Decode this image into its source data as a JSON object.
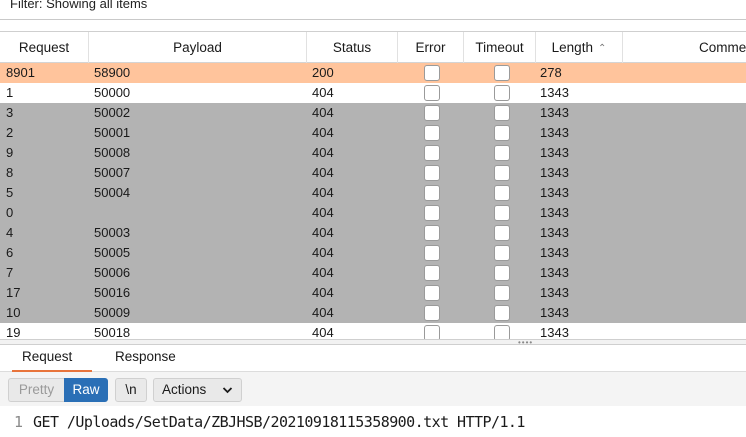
{
  "filter": {
    "text": "Filter: Showing all items"
  },
  "columns": [
    "Request",
    "Payload",
    "Status",
    "Error",
    "Timeout",
    "Length",
    "Comme"
  ],
  "sort_indicator": "^",
  "rows": [
    {
      "request": "8901",
      "payload": "58900",
      "status": "200",
      "length": "278",
      "style": "sel"
    },
    {
      "request": "1",
      "payload": "50000",
      "status": "404",
      "length": "1343",
      "style": "white"
    },
    {
      "request": "3",
      "payload": "50002",
      "status": "404",
      "length": "1343",
      "style": "gray"
    },
    {
      "request": "2",
      "payload": "50001",
      "status": "404",
      "length": "1343",
      "style": "gray"
    },
    {
      "request": "9",
      "payload": "50008",
      "status": "404",
      "length": "1343",
      "style": "gray"
    },
    {
      "request": "8",
      "payload": "50007",
      "status": "404",
      "length": "1343",
      "style": "gray"
    },
    {
      "request": "5",
      "payload": "50004",
      "status": "404",
      "length": "1343",
      "style": "gray"
    },
    {
      "request": "0",
      "payload": "",
      "status": "404",
      "length": "1343",
      "style": "gray"
    },
    {
      "request": "4",
      "payload": "50003",
      "status": "404",
      "length": "1343",
      "style": "gray"
    },
    {
      "request": "6",
      "payload": "50005",
      "status": "404",
      "length": "1343",
      "style": "gray"
    },
    {
      "request": "7",
      "payload": "50006",
      "status": "404",
      "length": "1343",
      "style": "gray"
    },
    {
      "request": "17",
      "payload": "50016",
      "status": "404",
      "length": "1343",
      "style": "gray"
    },
    {
      "request": "10",
      "payload": "50009",
      "status": "404",
      "length": "1343",
      "style": "gray"
    },
    {
      "request": "19",
      "payload": "50018",
      "status": "404",
      "length": "1343",
      "style": "white"
    }
  ],
  "tabs": {
    "request": "Request",
    "response": "Response"
  },
  "toolbar": {
    "pretty": "Pretty",
    "raw": "Raw",
    "newline": "\\n",
    "actions": "Actions"
  },
  "editor": {
    "line_number": "1",
    "line1": "GET /Uploads/SetData/ZBJHSB/20210918115358900.txt HTTP/1.1"
  },
  "colors": {
    "selected_row": "#ffc49c",
    "gray_row": "#b3b3b3",
    "accent_tab": "#e8743b",
    "raw_button": "#2a6fb6"
  }
}
